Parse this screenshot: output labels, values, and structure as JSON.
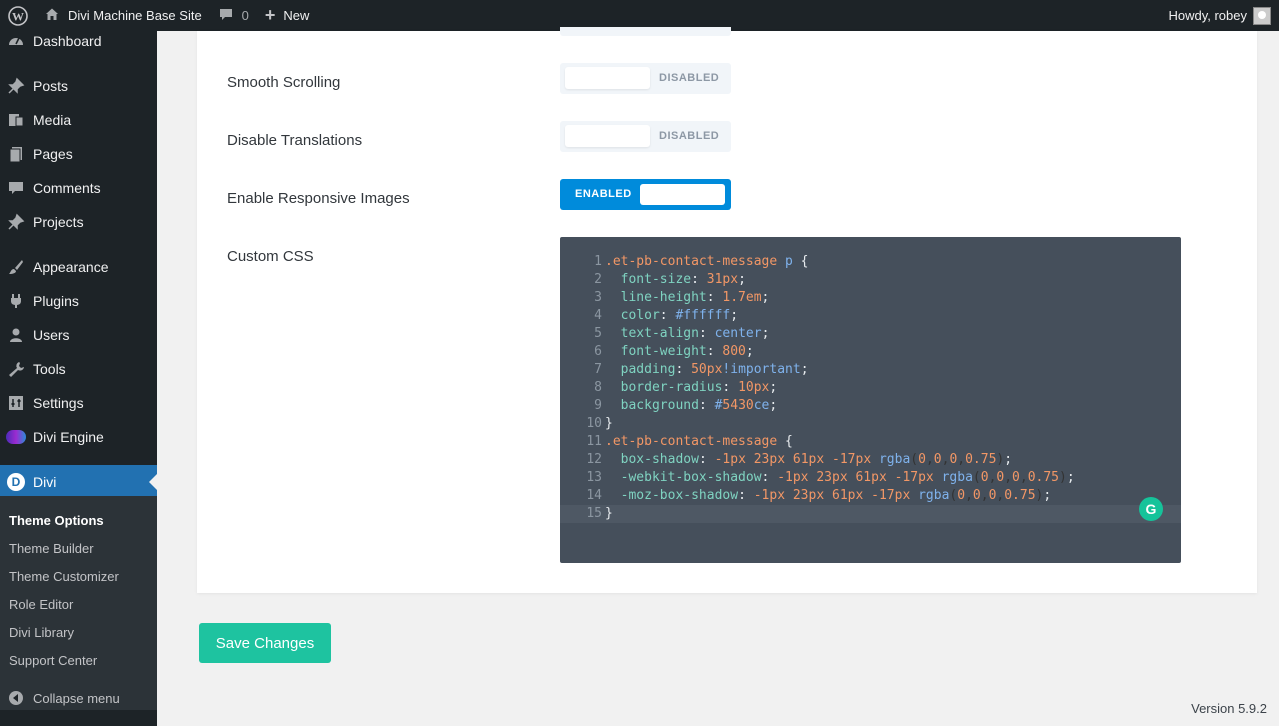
{
  "adminbar": {
    "site_name": "Divi Machine Base Site",
    "comments_count": "0",
    "new_label": "New",
    "greeting": "Howdy, robey"
  },
  "sidebar": {
    "items": [
      {
        "label": "Dashboard",
        "icon": "dashboard-icon"
      },
      {
        "label": "Posts",
        "icon": "pin-icon"
      },
      {
        "label": "Media",
        "icon": "media-icon"
      },
      {
        "label": "Pages",
        "icon": "pages-icon"
      },
      {
        "label": "Comments",
        "icon": "comment-icon"
      },
      {
        "label": "Projects",
        "icon": "pin-icon"
      },
      {
        "label": "Appearance",
        "icon": "brush-icon"
      },
      {
        "label": "Plugins",
        "icon": "plug-icon"
      },
      {
        "label": "Users",
        "icon": "user-icon"
      },
      {
        "label": "Tools",
        "icon": "wrench-icon"
      },
      {
        "label": "Settings",
        "icon": "settings-icon"
      },
      {
        "label": "Divi Engine",
        "icon": "divi-engine-icon"
      },
      {
        "label": "Divi",
        "icon": "divi-icon"
      }
    ],
    "submenu": [
      "Theme Options",
      "Theme Builder",
      "Theme Customizer",
      "Role Editor",
      "Divi Library",
      "Support Center"
    ],
    "collapse_label": "Collapse menu"
  },
  "options": {
    "smooth_scrolling": {
      "label": "Smooth Scrolling",
      "state": "DISABLED"
    },
    "disable_translations": {
      "label": "Disable Translations",
      "state": "DISABLED"
    },
    "responsive_images": {
      "label": "Enable Responsive Images",
      "state": "ENABLED"
    },
    "custom_css": {
      "label": "Custom CSS"
    }
  },
  "css_lines": [
    ".et-pb-contact-message p {",
    "  font-size: 31px;",
    "  line-height: 1.7em;",
    "  color: #ffffff;",
    "  text-align: center;",
    "  font-weight: 800;",
    "  padding: 50px!important;",
    "  border-radius: 10px;",
    "  background: #5430ce;",
    "}",
    ".et-pb-contact-message {",
    "  box-shadow: -1px 23px 61px -17px rgba(0,0,0,0.75);",
    "  -webkit-box-shadow: -1px 23px 61px -17px rgba(0,0,0,0.75);",
    "  -moz-box-shadow: -1px 23px 61px -17px rgba(0,0,0,0.75);",
    "}"
  ],
  "save_label": "Save Changes",
  "version": "Version 5.9.2",
  "colors": {
    "accent": "#2271b1",
    "toggle_on": "#008bdb",
    "save": "#1ec3a0",
    "editor_bg": "#454f5b"
  }
}
